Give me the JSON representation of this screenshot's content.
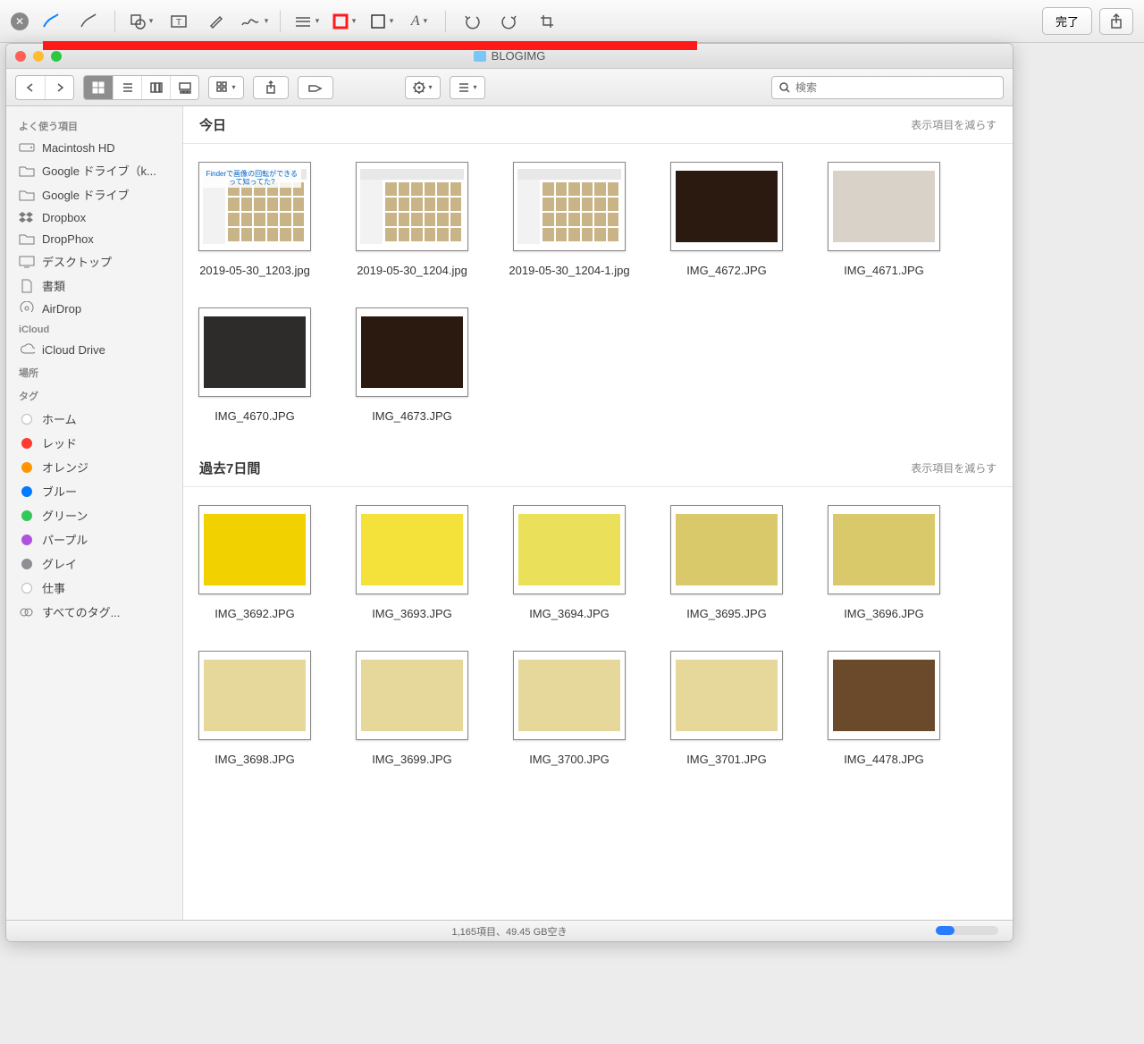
{
  "markup_toolbar": {
    "done_label": "完了"
  },
  "finder": {
    "title": "BLOGIMG",
    "search_placeholder": "検索",
    "statusbar": "1,165項目、49.45 GB空き"
  },
  "sidebar": {
    "sections": [
      {
        "header": "よく使う項目",
        "items": [
          {
            "icon": "hdd",
            "label": "Macintosh HD"
          },
          {
            "icon": "folder",
            "label": "Google ドライブ（k..."
          },
          {
            "icon": "folder",
            "label": "Google ドライブ"
          },
          {
            "icon": "dropbox",
            "label": "Dropbox"
          },
          {
            "icon": "folder",
            "label": "DropPhox"
          },
          {
            "icon": "desktop",
            "label": "デスクトップ"
          },
          {
            "icon": "docs",
            "label": "書類"
          },
          {
            "icon": "airdrop",
            "label": "AirDrop"
          }
        ]
      },
      {
        "header": "iCloud",
        "items": [
          {
            "icon": "cloud",
            "label": "iCloud Drive"
          }
        ]
      },
      {
        "header": "場所",
        "items": []
      },
      {
        "header": "タグ",
        "items": [
          {
            "icon": "tag",
            "color": "#ffffff",
            "stroke": "#bbb",
            "label": "ホーム"
          },
          {
            "icon": "tag",
            "color": "#ff3b30",
            "label": "レッド"
          },
          {
            "icon": "tag",
            "color": "#ff9500",
            "label": "オレンジ"
          },
          {
            "icon": "tag",
            "color": "#007aff",
            "label": "ブルー"
          },
          {
            "icon": "tag",
            "color": "#34c759",
            "label": "グリーン"
          },
          {
            "icon": "tag",
            "color": "#af52de",
            "label": "パープル"
          },
          {
            "icon": "tag",
            "color": "#8e8e93",
            "label": "グレイ"
          },
          {
            "icon": "tag",
            "color": "#ffffff",
            "stroke": "#bbb",
            "label": "仕事"
          },
          {
            "icon": "alltags",
            "label": "すべてのタグ..."
          }
        ]
      }
    ]
  },
  "content": {
    "show_less": "表示項目を減らす",
    "sections": [
      {
        "title": "今日",
        "files": [
          {
            "name": "2019-05-30_1203.jpg",
            "thumb": "finder1"
          },
          {
            "name": "2019-05-30_1204.jpg",
            "thumb": "finder2"
          },
          {
            "name": "2019-05-30_1204-1.jpg",
            "thumb": "finder2"
          },
          {
            "name": "IMG_4672.JPG",
            "thumb": "choco"
          },
          {
            "name": "IMG_4671.JPG",
            "thumb": "pack"
          },
          {
            "name": "IMG_4670.JPG",
            "thumb": "darkpack"
          },
          {
            "name": "IMG_4673.JPG",
            "thumb": "choco"
          }
        ]
      },
      {
        "title": "過去7日間",
        "files": [
          {
            "name": "IMG_3692.JPG",
            "thumb": "ramen-y"
          },
          {
            "name": "IMG_3693.JPG",
            "thumb": "ramen-y2"
          },
          {
            "name": "IMG_3694.JPG",
            "thumb": "ramen-y3"
          },
          {
            "name": "IMG_3695.JPG",
            "thumb": "ramen-open"
          },
          {
            "name": "IMG_3696.JPG",
            "thumb": "ramen-open"
          },
          {
            "name": "IMG_3698.JPG",
            "thumb": "noodle"
          },
          {
            "name": "IMG_3699.JPG",
            "thumb": "noodle"
          },
          {
            "name": "IMG_3700.JPG",
            "thumb": "noodle"
          },
          {
            "name": "IMG_3701.JPG",
            "thumb": "noodle"
          },
          {
            "name": "IMG_4478.JPG",
            "thumb": "bento"
          }
        ]
      }
    ]
  },
  "thumbs": {
    "finder1": {
      "bg": "#f6f6f6",
      "inner": "📁",
      "overlay": "Finderで画像の回転ができるって知ってた?"
    },
    "finder2": {
      "bg": "#f6f6f6",
      "inner": "📁"
    },
    "choco": {
      "bg": "#2a1a10"
    },
    "pack": {
      "bg": "#d8d2c9"
    },
    "darkpack": {
      "bg": "#2e2c2a"
    },
    "ramen-y": {
      "bg": "#f2d100"
    },
    "ramen-y2": {
      "bg": "#f4e23a"
    },
    "ramen-y3": {
      "bg": "#eae05a"
    },
    "ramen-open": {
      "bg": "#d9c96a"
    },
    "noodle": {
      "bg": "#e6d89a"
    },
    "bento": {
      "bg": "#6a4a2a"
    }
  }
}
